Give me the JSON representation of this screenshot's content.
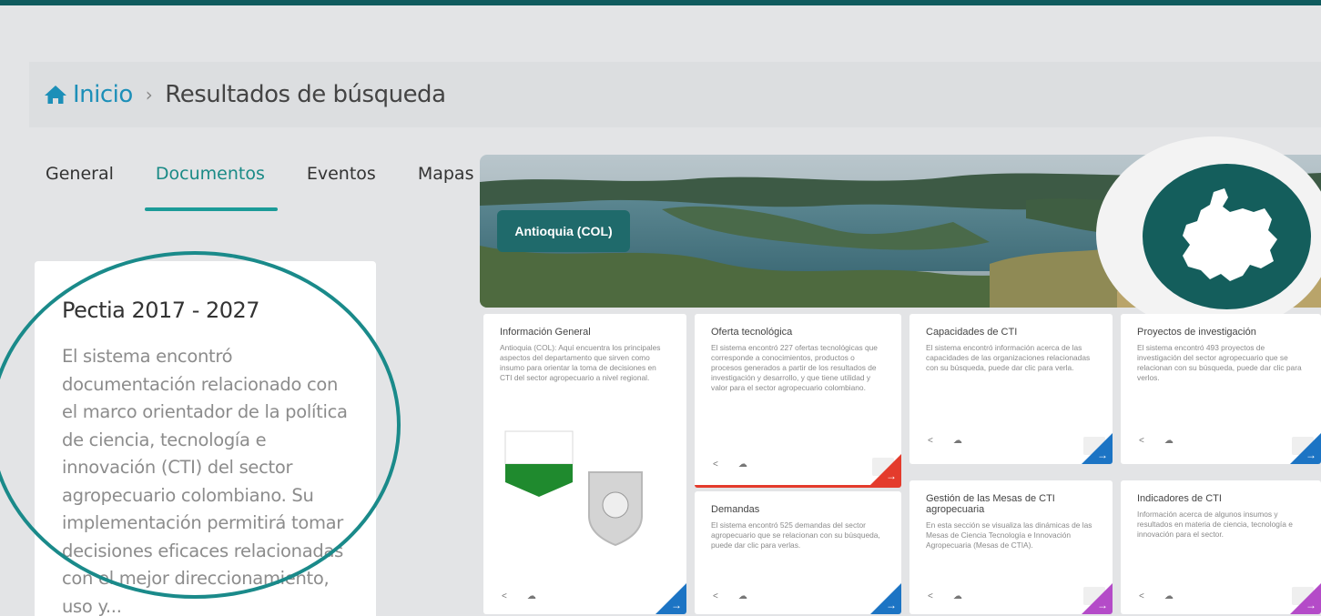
{
  "breadcrumb": {
    "home": "Inicio",
    "separator": "›",
    "current": "Resultados de búsqueda"
  },
  "tabs": [
    {
      "label": "General"
    },
    {
      "label": "Documentos"
    },
    {
      "label": "Eventos"
    },
    {
      "label": "Mapas"
    }
  ],
  "active_tab": "Documentos",
  "document": {
    "title": "Pectia 2017 - 2027",
    "body": "El sistema encontró documentación relacionado con el marco orientador de la política de ciencia, tecnología e innovación (CTI) del sector agropecuario colombiano. Su implementación permitirá tomar decisiones eficaces relacionadas con el mejor direccionamiento, uso y..."
  },
  "region": {
    "label": "Antioquia (COL)"
  },
  "cards": [
    {
      "title": "Información General",
      "text": "Antioquia (COL): Aquí encuentra los principales aspectos del departamento que sirven como insumo para orientar la toma de decisiones en CTI del sector agropecuario a nivel regional."
    },
    {
      "title": "Oferta tecnológica",
      "text": "El sistema encontró 227 ofertas tecnológicas que corresponde a conocimientos, productos o procesos generados a partir de los resultados de investigación y desarrollo, y que tiene utilidad y valor para el sector agropecuario colombiano."
    },
    {
      "title": "Demandas",
      "text": "El sistema encontró 525 demandas del sector agropecuario que se relacionan con su búsqueda, puede dar clic para verlas."
    },
    {
      "title": "Capacidades de CTI",
      "text": "El sistema encontró información acerca de las capacidades de las organizaciones relacionadas con su búsqueda, puede dar clic para verla."
    },
    {
      "title": "Gestión de las Mesas de CTI agropecuaria",
      "text": "En esta sección se visualiza las dinámicas de las Mesas de Ciencia Tecnología e Innovación Agropecuaria (Mesas de CTIA)."
    },
    {
      "title": "Proyectos de investigación",
      "text": "El sistema encontró 493 proyectos de investigación del sector agropecuario que se relacionan con su búsqueda, puede dar clic para verlos."
    },
    {
      "title": "Indicadores de CTI",
      "text": "Información acerca de algunos insumos y resultados en materia de ciencia, tecnología e innovación para el sector."
    }
  ],
  "action_icons": [
    "share-icon",
    "cloud-icon"
  ],
  "corner_arrow": "→",
  "colors": {
    "primary_teal": "#1a8a86",
    "dark_teal": "#145e5c",
    "blue": "#1c74c4",
    "red": "#e43b2c",
    "purple": "#b44bc8",
    "link_blue": "#1c8fb8"
  }
}
